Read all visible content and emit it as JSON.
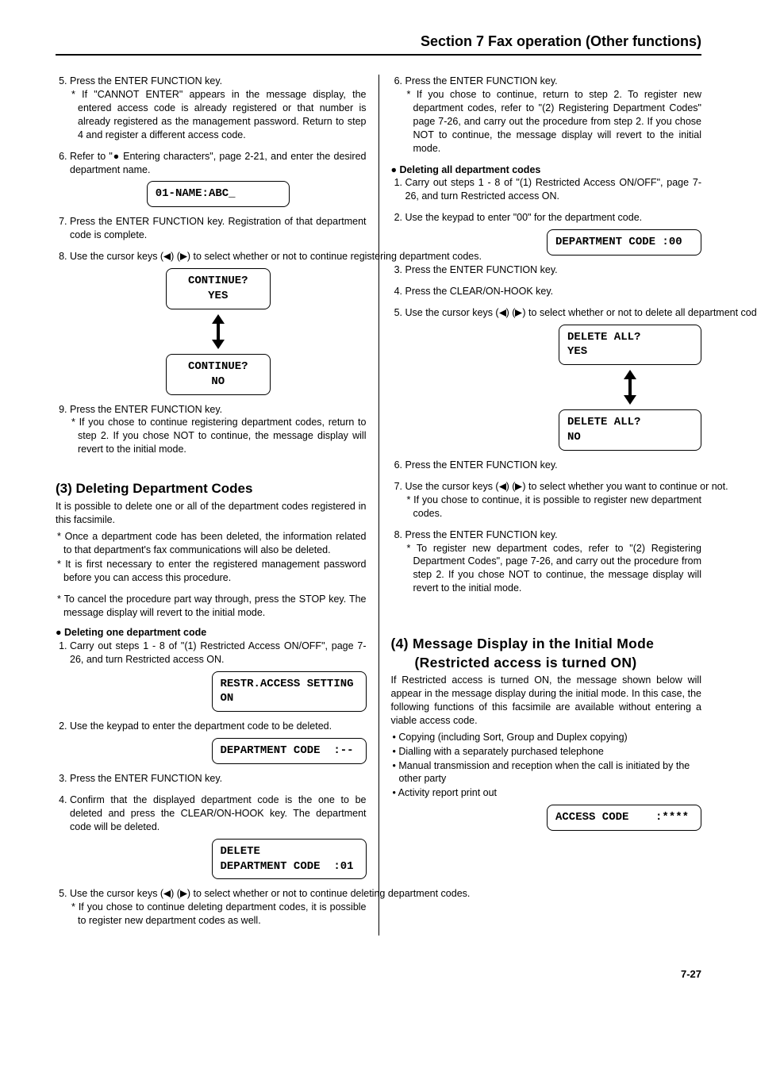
{
  "header": "Section 7   Fax operation (Other functions)",
  "left": {
    "s5": "Press the ENTER FUNCTION key.",
    "s5note": "If \"CANNOT ENTER\" appears in the message display, the entered access code is already registered or that number is already registered as the management password. Return to step 4 and register a different access code.",
    "s6a": "Refer to \"● Entering characters\", page 2-21, and enter the desired department name.",
    "lcd1": "01-NAME:ABC_",
    "s7": "Press the ENTER FUNCTION key. Registration of that department code is complete.",
    "s8a": "Use the cursor keys (",
    "s8b": ") (",
    "s8c": ") to select whether or not to continue registering department codes.",
    "lcd2a": "CONTINUE?\nYES",
    "lcd2b": "CONTINUE?\nNO",
    "s9": "Press the ENTER FUNCTION key.",
    "s9note": "If you chose to continue registering department codes, return to step 2. If you chose NOT to continue, the message display will revert to the initial mode.",
    "h3": "(3) Deleting Department Codes",
    "h3p": "It is possible to delete one or all of the department codes registered in this facsimile.",
    "h3s1": "Once a department code has been deleted, the information related to that department's fax communications will also be deleted.",
    "h3s2": "It is first necessary to enter the registered management password before you can access this procedure.",
    "h3s3": "To cancel the procedure part way through, press the STOP key. The message display will revert to the initial mode.",
    "bh1": "Deleting one department code",
    "d1": "Carry out steps 1 - 8 of \"(1) Restricted Access ON/OFF\", page 7-26, and turn Restricted access ON.",
    "lcd3": "RESTR.ACCESS SETTING\nON",
    "d2": "Use the keypad to enter the department code to be deleted.",
    "lcd4": "DEPARTMENT CODE  :--",
    "d3": "Press the ENTER FUNCTION key.",
    "d4": "Confirm that the displayed department code is the one to be deleted and press the CLEAR/ON-HOOK key. The department code will be deleted.",
    "lcd5": "DELETE\nDEPARTMENT CODE  :01",
    "d5a": "Use the cursor keys (",
    "d5b": ") (",
    "d5c": ") to select whether or not to continue deleting department codes.",
    "d5note": "If you chose to continue deleting department codes, it is possible to register new department codes as well."
  },
  "right": {
    "s6": "Press the ENTER FUNCTION key.",
    "s6note": "If you chose to continue, return to step 2. To register new department codes, refer to \"(2) Registering Department Codes\" page 7-26, and carry out the procedure from step 2. If you chose NOT to continue, the message display will revert to the initial mode.",
    "bh2": "Deleting all department codes",
    "a1": "Carry out steps 1 - 8 of \"(1) Restricted Access ON/OFF\", page 7-26, and turn Restricted access ON.",
    "a2": "Use the keypad to enter \"00\" for the department code.",
    "lcd6": "DEPARTMENT CODE :00",
    "a3": "Press the ENTER FUNCTION key.",
    "a4": "Press the CLEAR/ON-HOOK key.",
    "a5a": "Use the cursor keys (",
    "a5b": ") (",
    "a5c": ") to select whether or not to delete all department codes.",
    "lcd7a": "DELETE ALL?\nYES",
    "lcd7b": "DELETE ALL?\nNO",
    "a6": "Press the ENTER FUNCTION key.",
    "a7a": "Use the cursor keys (",
    "a7b": ") (",
    "a7c": ") to select whether you want to continue or not.",
    "a7note": "If you chose to continue, it is possible to register new department codes.",
    "a8": "Press the ENTER FUNCTION key.",
    "a8note": "To register new department codes, refer to \"(2) Registering Department Codes\", page 7-26, and carry out the procedure from step 2. If you chose NOT to continue, the message display will revert to the initial mode.",
    "h4a": "(4) Message Display in the Initial Mode",
    "h4b": "(Restricted access is turned ON)",
    "h4p": "If Restricted access is turned ON, the message shown below will appear in the message display during the initial mode. In this case, the following functions of this facsimile are available without entering a viable access code.",
    "b1": "Copying (including Sort, Group and Duplex copying)",
    "b2": "Dialling with a separately purchased telephone",
    "b3": "Manual transmission and reception when the call is initiated by the other party",
    "b4": "Activity report print out",
    "lcd8": "ACCESS CODE    :****",
    "pagenum": "7-27"
  }
}
